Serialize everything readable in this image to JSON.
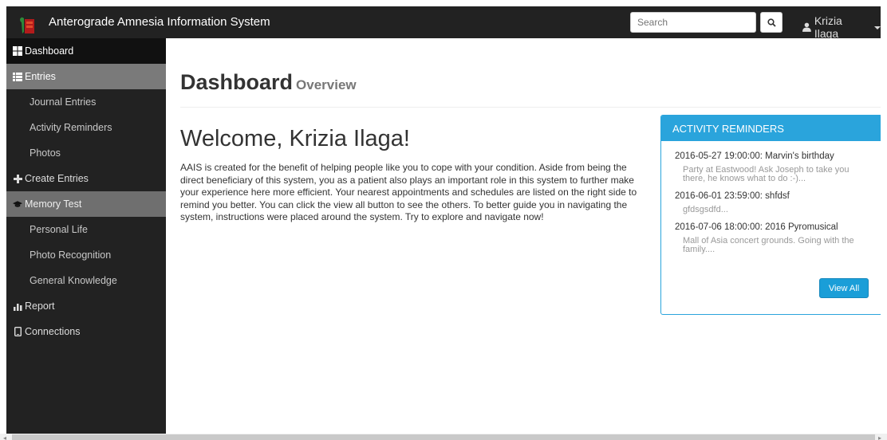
{
  "navbar": {
    "brand": "Anterograde Amnesia Information System",
    "search_placeholder": "Search",
    "user_name": "Krizia Ilaga"
  },
  "sidebar": {
    "items": [
      {
        "label": "Dashboard",
        "icon": "dashboard-icon"
      },
      {
        "label": "Entries",
        "icon": "list-icon"
      },
      {
        "label": "Journal Entries"
      },
      {
        "label": "Activity Reminders"
      },
      {
        "label": "Photos"
      },
      {
        "label": "Create Entries",
        "icon": "plus-icon"
      },
      {
        "label": "Memory Test",
        "icon": "graduation-cap-icon"
      },
      {
        "label": "Personal Life"
      },
      {
        "label": "Photo Recognition"
      },
      {
        "label": "General Knowledge"
      },
      {
        "label": "Report",
        "icon": "bar-chart-icon"
      },
      {
        "label": "Connections",
        "icon": "phone-icon"
      }
    ]
  },
  "main": {
    "title": "Dashboard",
    "subtitle": "Overview",
    "welcome": "Welcome, Krizia Ilaga!",
    "intro": "AAIS is created for the benefit of helping people like you to cope with your condition. Aside from being the direct beneficiary of this system, you as a patient also plays an important role in this system to further make your experience here more efficient. Your nearest appointments and schedules are listed on the right side to remind you better. You can click the view all button to see the others. To better guide you in navigating the system, instructions were placed around the system. Try to explore and navigate now!"
  },
  "reminders": {
    "heading": "ACTIVITY REMINDERS",
    "items": [
      {
        "title": "2016-05-27 19:00:00: Marvin's birthday",
        "desc": "Party at Eastwood! Ask Joseph to take you there, he knows what to do :-)..."
      },
      {
        "title": "2016-06-01 23:59:00: shfdsf",
        "desc": "gfdsgsdfd..."
      },
      {
        "title": "2016-07-06 18:00:00: 2016 Pyromusical",
        "desc": "Mall of Asia concert grounds. Going with the family...."
      }
    ],
    "view_all": "View All"
  },
  "colors": {
    "navbar_bg": "#222222",
    "panel_accent": "#2aa4dc",
    "button_primary": "#1a9ed8"
  }
}
